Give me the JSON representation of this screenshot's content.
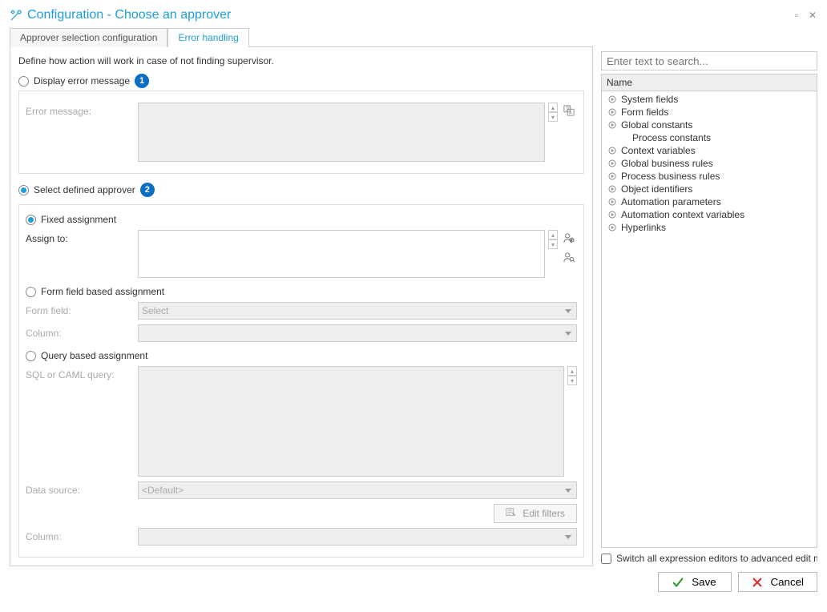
{
  "title": "Configuration - Choose an approver",
  "tabs": {
    "approver_selection": "Approver selection configuration",
    "error_handling": "Error handling"
  },
  "intro": "Define how action will work in case of not finding supervisor.",
  "options": {
    "display_error": "Display error message",
    "select_defined": "Select defined approver"
  },
  "error_panel": {
    "label": "Error message:"
  },
  "fixed": {
    "title": "Fixed assignment",
    "assign_to": "Assign to:"
  },
  "formfield": {
    "title": "Form field based assignment",
    "formfield": "Form field:",
    "select_placeholder": "Select",
    "column": "Column:"
  },
  "query": {
    "title": "Query based assignment",
    "sql": "SQL or CAML query:",
    "datasource": "Data source:",
    "default": "<Default>",
    "edit_filters": "Edit filters",
    "column": "Column:"
  },
  "badges": {
    "one": "1",
    "two": "2"
  },
  "search": {
    "placeholder": "Enter text to search..."
  },
  "tree": {
    "header": "Name",
    "items": [
      {
        "label": "System fields",
        "expandable": true
      },
      {
        "label": "Form fields",
        "expandable": true
      },
      {
        "label": "Global constants",
        "expandable": true
      },
      {
        "label": "Process constants",
        "expandable": false
      },
      {
        "label": "Context variables",
        "expandable": true
      },
      {
        "label": "Global business rules",
        "expandable": true
      },
      {
        "label": "Process business rules",
        "expandable": true
      },
      {
        "label": "Object identifiers",
        "expandable": true
      },
      {
        "label": "Automation parameters",
        "expandable": true
      },
      {
        "label": "Automation context variables",
        "expandable": true
      },
      {
        "label": "Hyperlinks",
        "expandable": true
      }
    ]
  },
  "switch_label": "Switch all expression editors to advanced edit m...",
  "buttons": {
    "save": "Save",
    "cancel": "Cancel"
  }
}
